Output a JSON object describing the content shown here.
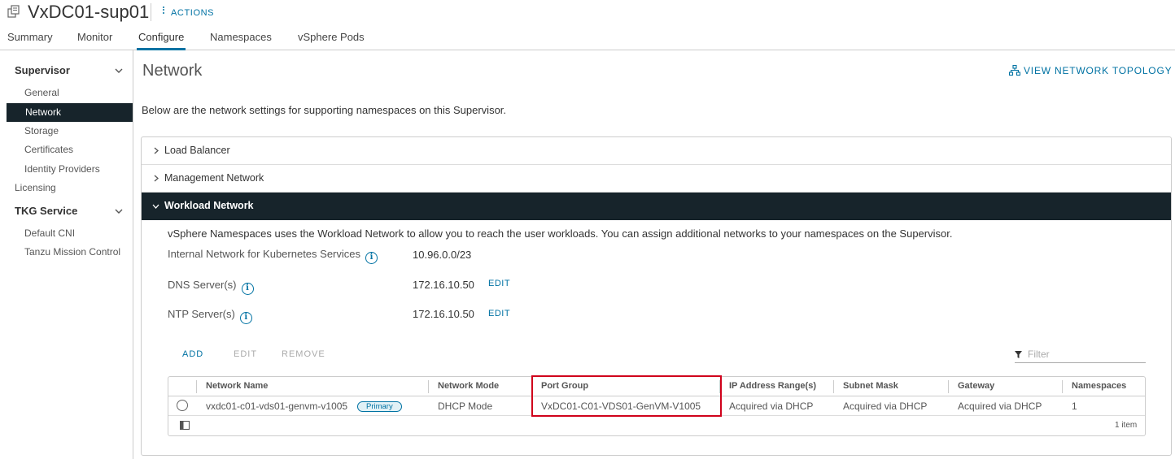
{
  "header": {
    "title": "VxDC01-sup01",
    "actions_label": "ACTIONS"
  },
  "tabs": [
    {
      "label": "Summary"
    },
    {
      "label": "Monitor"
    },
    {
      "label": "Configure",
      "active": true
    },
    {
      "label": "Namespaces"
    },
    {
      "label": "vSphere Pods"
    }
  ],
  "sidebar": {
    "group1": "Supervisor",
    "group1_items": [
      "General",
      "Network",
      "Storage",
      "Certificates",
      "Identity Providers"
    ],
    "licensing": "Licensing",
    "group2": "TKG Service",
    "group2_items": [
      "Default CNI",
      "Tanzu Mission Control"
    ]
  },
  "main": {
    "title": "Network",
    "topology_link": "VIEW NETWORK TOPOLOGY",
    "description": "Below are the network settings for supporting namespaces on this Supervisor.",
    "sections": [
      "Load Balancer",
      "Management Network",
      "Workload Network"
    ]
  },
  "workload": {
    "description": "vSphere Namespaces uses the Workload Network to allow you to reach the user workloads. You can assign additional networks to your namespaces on the Supervisor.",
    "k8s_label": "Internal Network for Kubernetes Services",
    "k8s_value": "10.96.0.0/23",
    "dns_label": "DNS Server(s)",
    "dns_value": "172.16.10.50",
    "ntp_label": "NTP Server(s)",
    "ntp_value": "172.16.10.50",
    "edit_label": "EDIT",
    "info_glyph": "i"
  },
  "grid": {
    "add_label": "ADD",
    "edit_label": "EDIT",
    "remove_label": "REMOVE",
    "filter_placeholder": "Filter",
    "columns": [
      "Network Name",
      "Network Mode",
      "Port Group",
      "IP Address Range(s)",
      "Subnet Mask",
      "Gateway",
      "Namespaces"
    ],
    "row": {
      "network_name": "vxdc01-c01-vds01-genvm-v1005",
      "badge": "Primary",
      "network_mode": "DHCP Mode",
      "port_group": "VxDC01-C01-VDS01-GenVM-V1005",
      "ip_range": "Acquired via DHCP",
      "subnet_mask": "Acquired via DHCP",
      "gateway": "Acquired via DHCP",
      "namespaces": "1"
    },
    "footer_count": "1 item"
  },
  "colors": {
    "accent": "#0072a3",
    "dark": "#17242b",
    "highlight": "#d0011b"
  }
}
